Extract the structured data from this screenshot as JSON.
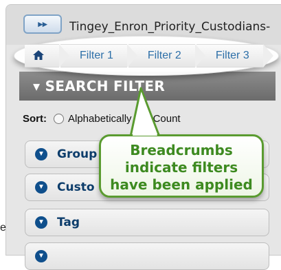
{
  "header": {
    "expand_glyph": "▸▸",
    "title": "Tingey_Enron_Priority_Custodians-"
  },
  "breadcrumb": {
    "home_icon": "home-icon",
    "items": [
      "Filter 1",
      "Filter 2",
      "Filter 3"
    ]
  },
  "search_filter": {
    "toggle_glyph": "▾",
    "label": "SEARCH FILTER"
  },
  "sort": {
    "label": "Sort:",
    "options": [
      {
        "label": "Alphabetically",
        "checked": false
      },
      {
        "label": "Count",
        "checked": true
      }
    ]
  },
  "facets": [
    {
      "label": "Group"
    },
    {
      "label": "Custo"
    },
    {
      "label": "Tag"
    }
  ],
  "left_partial_text": "e",
  "callout": {
    "text": "Breadcrumbs\nindicate filters\nhave been applied"
  },
  "colors": {
    "link_blue": "#2d6fa8",
    "facet_blue": "#0f4f8c",
    "callout_green": "#3d8a20"
  }
}
